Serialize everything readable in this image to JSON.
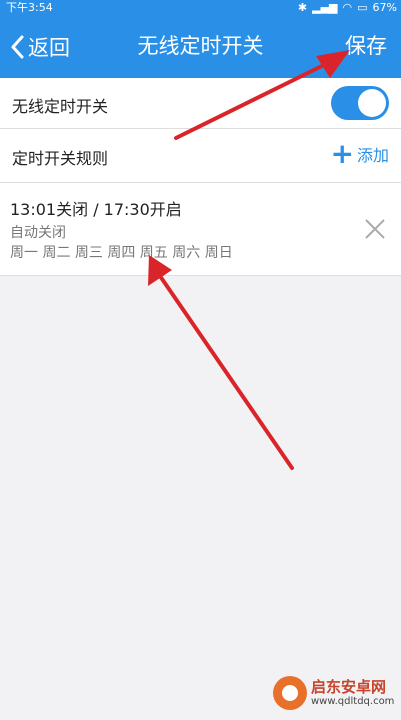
{
  "status_bar": {
    "time": "下午3:54",
    "battery": "67%"
  },
  "nav": {
    "back_label": "返回",
    "title": "无线定时开关",
    "save_label": "保存"
  },
  "settings": {
    "toggle_row_label": "无线定时开关",
    "toggle_on": true,
    "rules_row_label": "定时开关规则",
    "add_label": "添加"
  },
  "rule": {
    "times": "13:01关闭 / 17:30开启",
    "mode": "自动关闭",
    "days": "周一 周二 周三 周四 周五 周六 周日"
  },
  "watermark": {
    "name": "启东安卓网",
    "url": "www.qdltdq.com"
  },
  "colors": {
    "accent": "#2a8fe6",
    "annotation_arrow": "#d9252a"
  }
}
